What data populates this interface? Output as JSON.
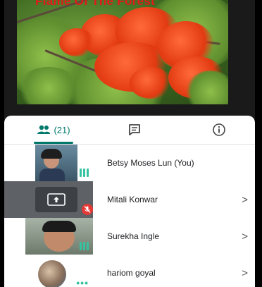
{
  "shared_screen": {
    "title": "Flame Of The Forest"
  },
  "tabs": {
    "people_count": "(21)",
    "people_icon": "people-icon",
    "chat_icon": "chat-icon",
    "info_icon": "info-icon"
  },
  "participants": [
    {
      "name": "Betsy Moses Lun (You)",
      "status": "speaking-bars",
      "chevron": ""
    },
    {
      "name": "Mitali Konwar",
      "status": "mic-muted",
      "chevron": ">"
    },
    {
      "name": "Surekha Ingle",
      "status": "speaking-bars",
      "chevron": ">"
    },
    {
      "name": "hariom goyal",
      "status": "dots",
      "chevron": ">"
    }
  ],
  "colors": {
    "accent": "#00796b",
    "speaking": "#35c2a0",
    "muted_badge": "#e53935",
    "title_red": "#e21a1a"
  }
}
